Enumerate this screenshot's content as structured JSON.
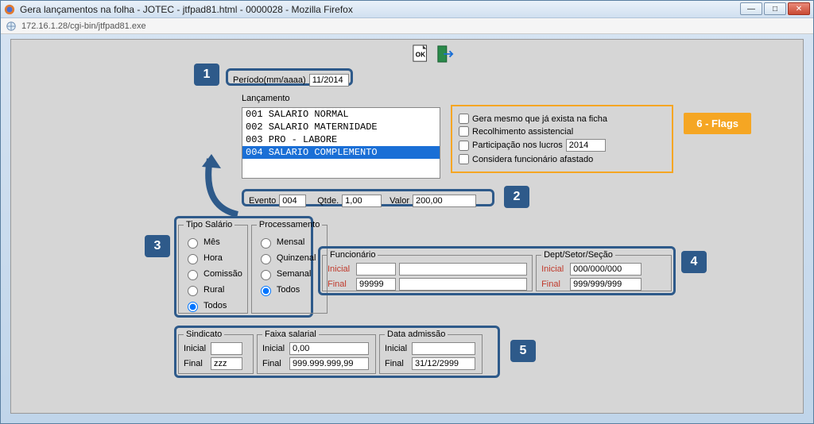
{
  "window": {
    "title": "Gera lançamentos na folha - JOTEC - jtfpad81.html - 0000028 - Mozilla Firefox",
    "url": "172.16.1.28/cgi-bin/jtfpad81.exe"
  },
  "periodo": {
    "label": "Período(mm/aaaa)",
    "value": "11/2014"
  },
  "lancamento": {
    "label": "Lançamento",
    "items": [
      "001 SALARIO NORMAL",
      "002 SALARIO MATERNIDADE",
      "003 PRO - LABORE",
      "004 SALARIO COMPLEMENTO"
    ],
    "selected_index": 3
  },
  "evento": {
    "label": "Evento",
    "value": "004"
  },
  "qtde": {
    "label": "Qtde.",
    "value": "1,00"
  },
  "valor": {
    "label": "Valor",
    "value": "200,00"
  },
  "flags": {
    "gera_mesmo": "Gera mesmo que já exista na ficha",
    "recolhimento": "Recolhimento assistencial",
    "participacao": "Participação nos lucros",
    "participacao_value": "2014",
    "considera": "Considera funcionário afastado",
    "badge": "6 - Flags"
  },
  "tipo_salario": {
    "legend": "Tipo Salário",
    "options": {
      "mes": "Mês",
      "hora": "Hora",
      "comissao": "Comissão",
      "rural": "Rural",
      "todos": "Todos"
    },
    "selected": "todos"
  },
  "processamento": {
    "legend": "Processamento",
    "options": {
      "mensal": "Mensal",
      "quinzenal": "Quinzenal",
      "semanal": "Semanal",
      "todos": "Todos"
    },
    "selected": "todos"
  },
  "funcionario": {
    "legend": "Funcionário",
    "inicial_label": "Inicial",
    "inicial_code": "",
    "inicial_name": "",
    "final_label": "Final",
    "final_code": "99999",
    "final_name": ""
  },
  "dept": {
    "legend": "Dept/Setor/Seção",
    "inicial_label": "Inicial",
    "inicial": "000/000/000",
    "final_label": "Final",
    "final": "999/999/999"
  },
  "sindicato": {
    "legend": "Sindicato",
    "inicial_label": "Inicial",
    "inicial": "",
    "final_label": "Final",
    "final": "zzz"
  },
  "faixa": {
    "legend": "Faixa salarial",
    "inicial_label": "Inicial",
    "inicial": "0,00",
    "final_label": "Final",
    "final": "999.999.999,99"
  },
  "admissao": {
    "legend": "Data admissão",
    "inicial_label": "Inicial",
    "inicial": "",
    "final_label": "Final",
    "final": "31/12/2999"
  },
  "badges": {
    "b1": "1",
    "b2": "2",
    "b3": "3",
    "b4": "4",
    "b5": "5"
  }
}
